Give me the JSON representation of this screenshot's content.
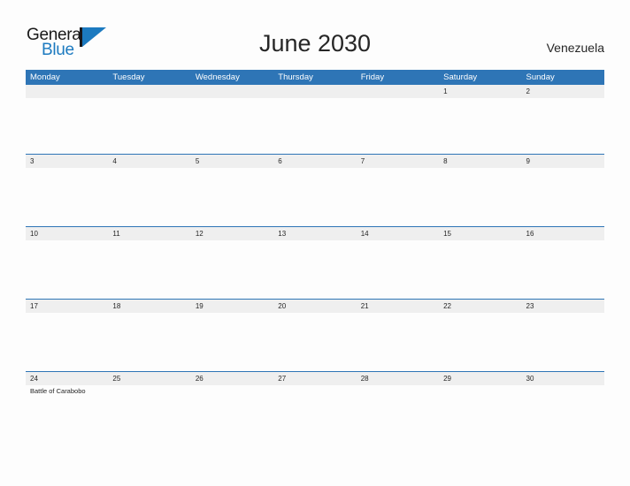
{
  "brand": {
    "word_one": "General",
    "word_two": "Blue",
    "mark": "triangle-flag-icon",
    "accent_color": "#1c7ac0"
  },
  "header": {
    "title": "June 2030",
    "country": "Venezuela"
  },
  "theme": {
    "header_blue": "#2e75b6",
    "row_gray": "#efefef",
    "page_bg": "#fdfdfd",
    "text": "#262626"
  },
  "calendar": {
    "month": "June",
    "year": "2030",
    "weekdays": [
      "Monday",
      "Tuesday",
      "Wednesday",
      "Thursday",
      "Friday",
      "Saturday",
      "Sunday"
    ],
    "weeks": [
      {
        "days": [
          {
            "num": "",
            "event": ""
          },
          {
            "num": "",
            "event": ""
          },
          {
            "num": "",
            "event": ""
          },
          {
            "num": "",
            "event": ""
          },
          {
            "num": "",
            "event": ""
          },
          {
            "num": "1",
            "event": ""
          },
          {
            "num": "2",
            "event": ""
          }
        ]
      },
      {
        "days": [
          {
            "num": "3",
            "event": ""
          },
          {
            "num": "4",
            "event": ""
          },
          {
            "num": "5",
            "event": ""
          },
          {
            "num": "6",
            "event": ""
          },
          {
            "num": "7",
            "event": ""
          },
          {
            "num": "8",
            "event": ""
          },
          {
            "num": "9",
            "event": ""
          }
        ]
      },
      {
        "days": [
          {
            "num": "10",
            "event": ""
          },
          {
            "num": "11",
            "event": ""
          },
          {
            "num": "12",
            "event": ""
          },
          {
            "num": "13",
            "event": ""
          },
          {
            "num": "14",
            "event": ""
          },
          {
            "num": "15",
            "event": ""
          },
          {
            "num": "16",
            "event": ""
          }
        ]
      },
      {
        "days": [
          {
            "num": "17",
            "event": ""
          },
          {
            "num": "18",
            "event": ""
          },
          {
            "num": "19",
            "event": ""
          },
          {
            "num": "20",
            "event": ""
          },
          {
            "num": "21",
            "event": ""
          },
          {
            "num": "22",
            "event": ""
          },
          {
            "num": "23",
            "event": ""
          }
        ]
      },
      {
        "days": [
          {
            "num": "24",
            "event": "Battle of Carabobo"
          },
          {
            "num": "25",
            "event": ""
          },
          {
            "num": "26",
            "event": ""
          },
          {
            "num": "27",
            "event": ""
          },
          {
            "num": "28",
            "event": ""
          },
          {
            "num": "29",
            "event": ""
          },
          {
            "num": "30",
            "event": ""
          }
        ]
      }
    ]
  }
}
